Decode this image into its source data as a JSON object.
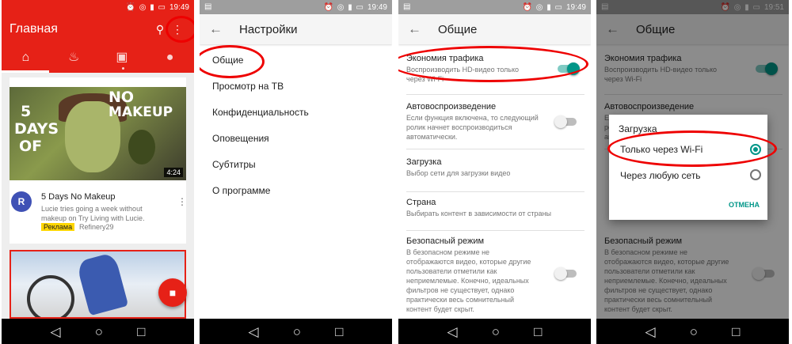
{
  "colors": {
    "youtube_red": "#e62117",
    "teal_accent": "#009688",
    "highlight_ellipse": "#ee0000"
  },
  "status": {
    "time1": "19:49",
    "time2": "19:49",
    "time3": "19:49",
    "time4": "19:51"
  },
  "home": {
    "title": "Главная",
    "tabs": [
      "home-icon",
      "trending-icon",
      "subscriptions-icon",
      "account-icon"
    ],
    "video": {
      "duration": "4:24",
      "thumb_text": [
        "NO",
        "MAKEUP",
        "5",
        "DAYS",
        "OF"
      ],
      "title": "5 Days No Makeup",
      "description": "Lucie tries going a week without makeup on Try Living with Lucie.",
      "ad_badge": "Реклама",
      "channel": "Refinery29"
    }
  },
  "settings": {
    "title": "Настройки",
    "items": [
      "Общие",
      "Просмотр на ТВ",
      "Конфиденциальность",
      "Оповещения",
      "Субтитры",
      "О программе"
    ]
  },
  "general": {
    "title": "Общие",
    "items": [
      {
        "title": "Экономия трафика",
        "desc": "Воспроизводить HD-видео только через Wi-Fi",
        "toggle": "on"
      },
      {
        "title": "Автовоспроизведение",
        "desc": "Если функция включена, то следующий ролик начнет воспроизводиться автоматически.",
        "toggle": "off"
      },
      {
        "title": "Загрузка",
        "desc": "Выбор сети для загрузки видео"
      },
      {
        "title": "Страна",
        "desc": "Выбирать контент в зависимости от страны"
      },
      {
        "title": "Безопасный режим",
        "desc": "В безопасном режиме не отображаются видео, которые другие пользователи отметили как неприемлемые. Конечно, идеальных фильтров не существует, однако практически весь сомнительный контент будет скрыт.",
        "toggle": "off"
      }
    ]
  },
  "dialog": {
    "title": "Загрузка",
    "options": [
      "Только через Wi-Fi",
      "Через любую сеть"
    ],
    "selected": "Только через Wi-Fi",
    "cancel": "ОТМЕНА"
  }
}
